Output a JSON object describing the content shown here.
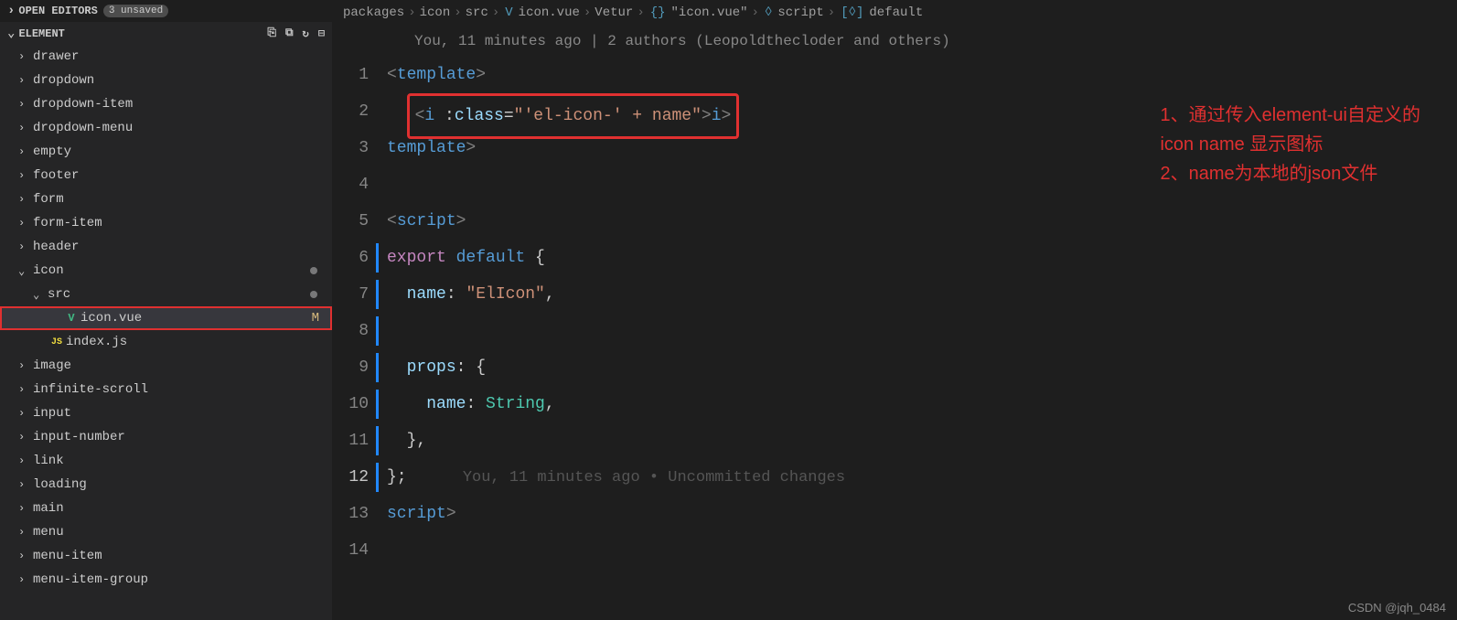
{
  "openEditors": {
    "label": "OPEN EDITORS",
    "badge": "3 unsaved"
  },
  "section": {
    "label": "ELEMENT"
  },
  "tree": [
    {
      "type": "folder",
      "label": "drawer",
      "indent": 0
    },
    {
      "type": "folder",
      "label": "dropdown",
      "indent": 0
    },
    {
      "type": "folder",
      "label": "dropdown-item",
      "indent": 0
    },
    {
      "type": "folder",
      "label": "dropdown-menu",
      "indent": 0
    },
    {
      "type": "folder",
      "label": "empty",
      "indent": 0
    },
    {
      "type": "folder",
      "label": "footer",
      "indent": 0
    },
    {
      "type": "folder",
      "label": "form",
      "indent": 0
    },
    {
      "type": "folder",
      "label": "form-item",
      "indent": 0
    },
    {
      "type": "folder",
      "label": "header",
      "indent": 0
    },
    {
      "type": "folder-open",
      "label": "icon",
      "indent": 0,
      "dot": true
    },
    {
      "type": "folder-open",
      "label": "src",
      "indent": 1,
      "dot": true
    },
    {
      "type": "file-vue",
      "label": "icon.vue",
      "indent": 2,
      "selected": true,
      "boxed": true,
      "status": "M"
    },
    {
      "type": "file-js",
      "label": "index.js",
      "indent": 1
    },
    {
      "type": "folder",
      "label": "image",
      "indent": 0
    },
    {
      "type": "folder",
      "label": "infinite-scroll",
      "indent": 0
    },
    {
      "type": "folder",
      "label": "input",
      "indent": 0
    },
    {
      "type": "folder",
      "label": "input-number",
      "indent": 0
    },
    {
      "type": "folder",
      "label": "link",
      "indent": 0
    },
    {
      "type": "folder",
      "label": "loading",
      "indent": 0
    },
    {
      "type": "folder",
      "label": "main",
      "indent": 0
    },
    {
      "type": "folder",
      "label": "menu",
      "indent": 0
    },
    {
      "type": "folder",
      "label": "menu-item",
      "indent": 0
    },
    {
      "type": "folder",
      "label": "menu-item-group",
      "indent": 0
    }
  ],
  "breadcrumbs": [
    "packages",
    "icon",
    "src",
    "icon.vue",
    "Vetur",
    "\"icon.vue\"",
    "script",
    "default"
  ],
  "gitlens": "You, 11 minutes ago | 2 authors (Leopoldthecloder and others)",
  "lineNumbers": [
    "1",
    "2",
    "3",
    "4",
    "5",
    "6",
    "7",
    "8",
    "9",
    "10",
    "11",
    "12",
    "13",
    "14"
  ],
  "code": {
    "l1": {
      "open": "<",
      "tag": "template",
      "close": ">"
    },
    "l2": {
      "open": "<",
      "tag": "i",
      "sp": " :",
      "attr": "class",
      "eq": "=",
      "str": "\"'el-icon-' + name\"",
      "cl1": "></",
      "tag2": "i",
      "cl2": ">"
    },
    "l3": {
      "open": "</",
      "tag": "template",
      "close": ">"
    },
    "l5": {
      "open": "<",
      "tag": "script",
      "close": ">"
    },
    "l6": {
      "kw1": "export",
      "kw2": "default",
      "brace": " {"
    },
    "l7": {
      "prop": "name",
      "colon": ": ",
      "str": "\"ElIcon\"",
      "comma": ","
    },
    "l9": {
      "prop": "props",
      "colon": ": {",
      "end": ""
    },
    "l10": {
      "prop": "name",
      "colon": ": ",
      "type": "String",
      "comma": ","
    },
    "l11": {
      "text": "},"
    },
    "l12": {
      "text": "};",
      "hint": "      You, 11 minutes ago • Uncommitted changes"
    },
    "l13": {
      "open": "</",
      "tag": "script",
      "close": ">"
    }
  },
  "currentLine": 12,
  "annotations": {
    "line1": "1、通过传入element-ui自定义的",
    "line2": "icon name 显示图标",
    "line3": "2、name为本地的json文件"
  },
  "watermark": "CSDN @jqh_0484"
}
